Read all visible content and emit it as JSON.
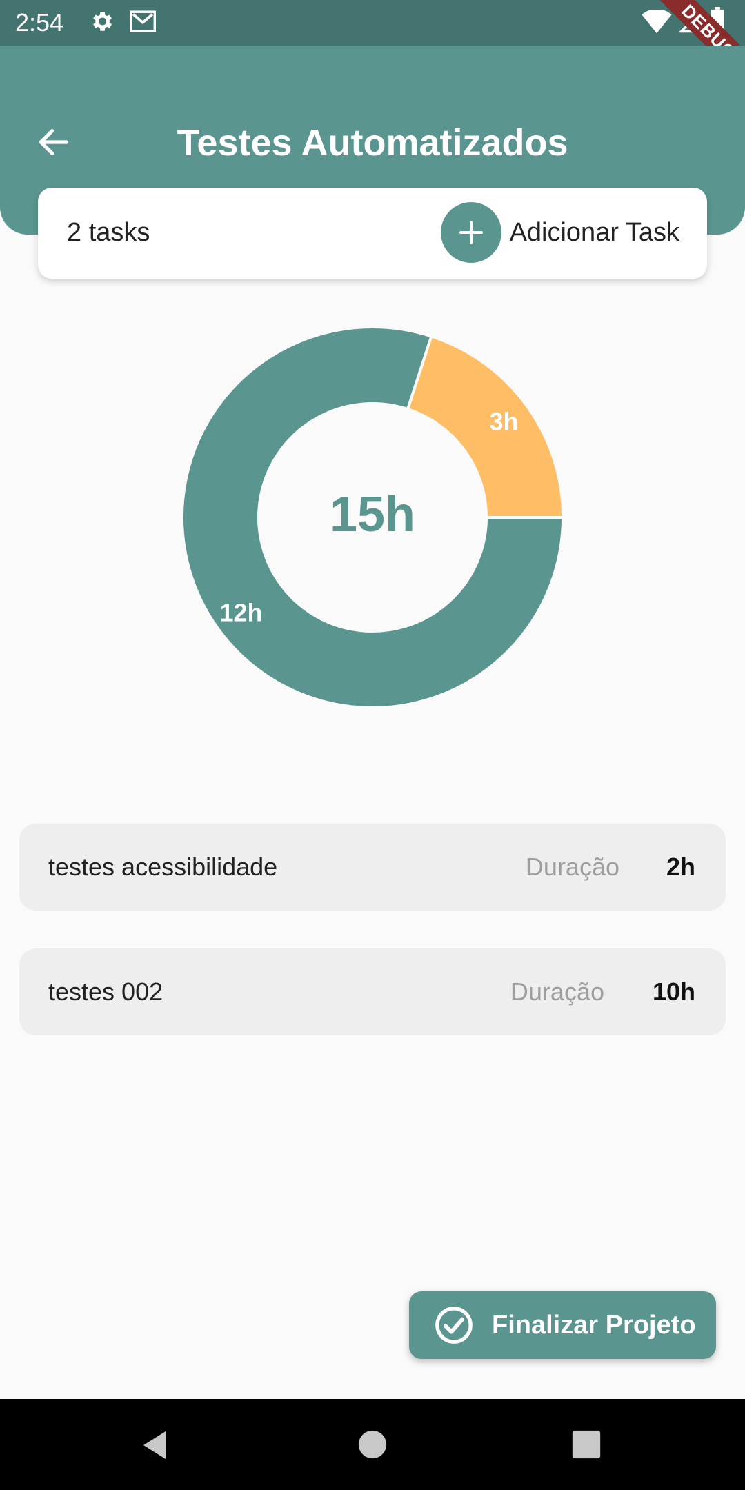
{
  "status_bar": {
    "time": "2:54",
    "icons": [
      "gear-icon",
      "gmail-icon",
      "wifi-icon",
      "signal-icon",
      "battery-icon"
    ]
  },
  "debug_banner": "DEBUG",
  "app_bar": {
    "title": "Testes Automatizados",
    "back_icon": "arrow-back-icon"
  },
  "summary": {
    "task_count": "2 tasks",
    "add_label": "Adicionar Task"
  },
  "chart_data": {
    "type": "pie",
    "variant": "donut",
    "center_label": "15h",
    "slices": [
      {
        "label": "12h",
        "value": 12,
        "color": "#5a968f"
      },
      {
        "label": "3h",
        "value": 3,
        "color": "#ffbd66"
      }
    ]
  },
  "tasks": [
    {
      "name": "testes acessibilidade",
      "duration_label": "Duração",
      "duration": "2h"
    },
    {
      "name": "testes 002",
      "duration_label": "Duração",
      "duration": "10h"
    }
  ],
  "finish_button": {
    "label": "Finalizar Projeto"
  },
  "colors": {
    "primary": "#5a968f",
    "accent": "#ffbd66",
    "status_bar": "#44746f"
  }
}
